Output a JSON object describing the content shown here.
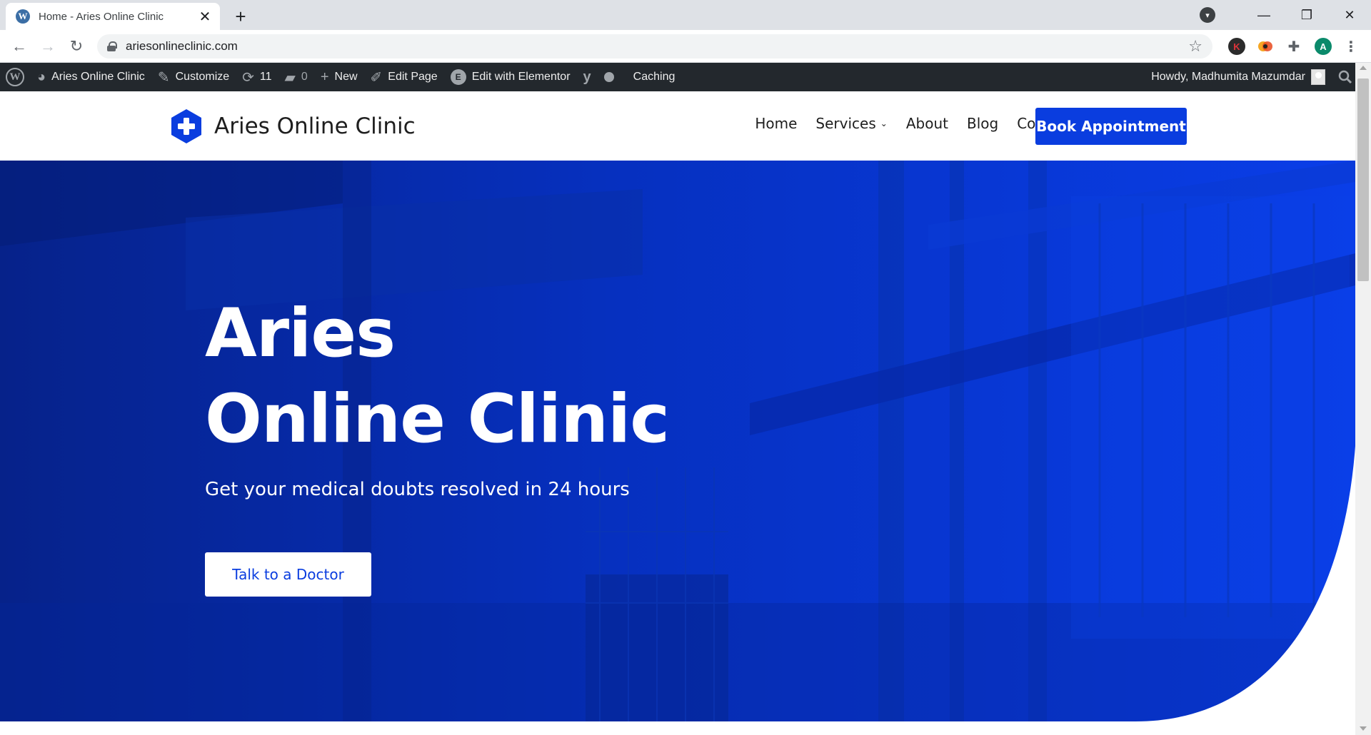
{
  "browser": {
    "tab_title": "Home - Aries Online Clinic",
    "favicon_letter": "W",
    "new_tab_symbol": "+",
    "url": "ariesonlineclinic.com",
    "profile_initial": "A",
    "ext_k_letter": "K"
  },
  "adminbar": {
    "site_name": "Aries Online Clinic",
    "customize": "Customize",
    "updates_count": "11",
    "comments_count": "0",
    "new": "New",
    "edit_page": "Edit Page",
    "edit_elementor": "Edit with Elementor",
    "caching": "Caching",
    "howdy": "Howdy, Madhumita Mazumdar"
  },
  "site": {
    "logo_text": "Aries Online Clinic",
    "nav": [
      "Home",
      "Services",
      "About",
      "Blog",
      "Contact"
    ],
    "book_button": "Book Appointment"
  },
  "hero": {
    "title_line1": "Aries",
    "title_line2": "Online Clinic",
    "subtitle": "Get your medical doubts resolved in 24 hours",
    "cta": "Talk to a Doctor"
  },
  "colors": {
    "brand_blue": "#0a3ddf",
    "hero_blue": "#0733c9",
    "adminbar": "#23282d"
  },
  "icons": [
    "wordpress-icon",
    "dashboard-icon",
    "brush-icon",
    "refresh-icon",
    "comment-icon",
    "plus-icon",
    "pencil-icon",
    "elementor-icon",
    "yoast-icon",
    "search-icon",
    "star-icon",
    "puzzle-icon",
    "lock-icon"
  ]
}
